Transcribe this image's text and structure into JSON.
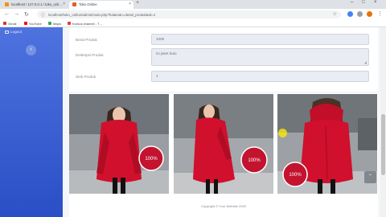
{
  "browser": {
    "tabs": [
      {
        "label": "localhost / 127.0.0.1 / toko_onli…",
        "favicon_color": "#f29111"
      },
      {
        "label": "Toko Online",
        "favicon_color": "#e35d22"
      }
    ],
    "new_tab": "+",
    "url": "localhost/toko_online/admin/main.php?halaman=detail_produk&id=4",
    "bookmarks": [
      {
        "label": "Gmail",
        "color": "#d93025"
      },
      {
        "label": "YouTube",
        "color": "#ff0000"
      },
      {
        "label": "Maps",
        "color": "#34a853"
      },
      {
        "label": "Kursus channel - T…",
        "color": "#e53935"
      }
    ]
  },
  "sidebar": {
    "logout_label": "Logout",
    "collapse_icon": "‹",
    "color_top": "#4e73df",
    "color_bottom": "#2a4fc6"
  },
  "form": {
    "berat_label": "Berat Produk",
    "berat_value": "1000",
    "deskripsi_label": "Deskripsi Produk",
    "deskripsi_value": "ini jaket bulu",
    "stok_label": "Stok Produk",
    "stok_value": "1"
  },
  "gallery": {
    "photos": [
      "product-photo-front",
      "product-photo-side",
      "product-photo-back"
    ],
    "jacket_color": "#d0102c",
    "badge_text": "100%"
  },
  "footer": {
    "copyright": "Copyright © Your Website 2020",
    "scroll_top_icon": "⌃"
  }
}
